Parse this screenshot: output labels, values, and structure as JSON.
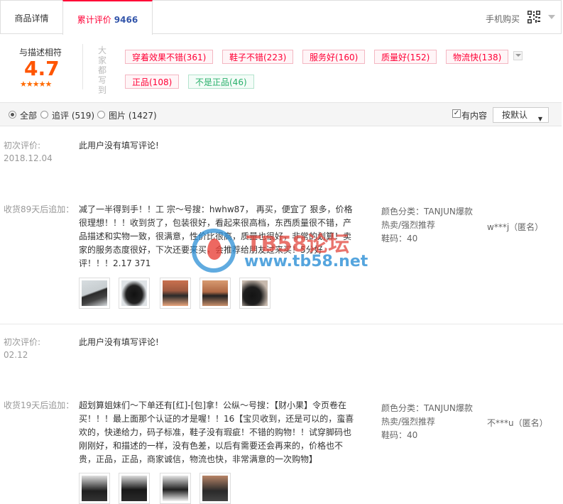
{
  "tabs": {
    "detail": "商品详情",
    "reviews_label": "累计评价",
    "reviews_count": "9466",
    "mobile_buy": "手机购买"
  },
  "rating": {
    "label": "与描述相符",
    "score": "4.7",
    "stars": "★★★★★",
    "vertical_text": "大家都写到"
  },
  "tags": [
    {
      "text": "穿着效果不错(361)",
      "type": "positive"
    },
    {
      "text": "鞋子不错(223)",
      "type": "positive"
    },
    {
      "text": "服务好(160)",
      "type": "positive"
    },
    {
      "text": "质量好(152)",
      "type": "positive"
    },
    {
      "text": "物流快(138)",
      "type": "positive"
    },
    {
      "text": "正品(108)",
      "type": "positive"
    },
    {
      "text": "不是正品(46)",
      "type": "negative"
    }
  ],
  "filter": {
    "all": "全部",
    "append": "追评 (519)",
    "pictures": "图片 (1427)",
    "has_content": "有内容",
    "sort": "按默认"
  },
  "reviews": [
    {
      "meta_label": "初次评价:",
      "date": "2018.12.04",
      "text": "此用户没有填写评论!"
    },
    {
      "meta_label": "收货89天后追加：",
      "text": "减了一半得到手！！工 宗～号搜：hwhw87， 再买，便宜了 狠多，价格很理想！！！收到货了，包装很好，看起来很高档，东西质量很不错，产品描述和实物一致，很满意，性价比很高，质量也很好，非常的划算！卖家的服务态度很好，下次还要来买，会推荐给朋友过来买！5分好评！！！2.17 371",
      "sku_color": "颜色分类：TANJUN爆款热卖/强烈推荐",
      "sku_size": "鞋码：40",
      "user": "w***j（匿名）"
    },
    {
      "meta_label": "初次评价:",
      "date": "02.12",
      "text": "此用户没有填写评论!"
    },
    {
      "meta_label": "收货19天后追加：",
      "text": "超划算姐妹们～下单还有[红]-[包]拿！公纵～号搜：【财小果】令页卷在买！！！最上面那个认证的才是喔！！16【宝贝收到，还是可以的，蛮喜欢的，快递给力，码子标准，鞋子没有瑕疵！不错的购物！！试穿脚码也刚刚好，和描述的一样，没有色差，以后有需要还会再来的，价格也不贵，正品，正品，商家诚信，物流也快，非常满意的一次购物】",
      "sku_color": "颜色分类：TANJUN爆款热卖/强烈推荐",
      "sku_size": "鞋码：40",
      "user": "不***u（匿名）"
    }
  ],
  "watermark": {
    "line1": "TB58论坛",
    "line2": "www.tb58.net"
  },
  "colors": {
    "accent": "#ff0036",
    "score": "#ff5500",
    "count_blue": "#3355aa",
    "negative_tag": "#29b06b"
  }
}
